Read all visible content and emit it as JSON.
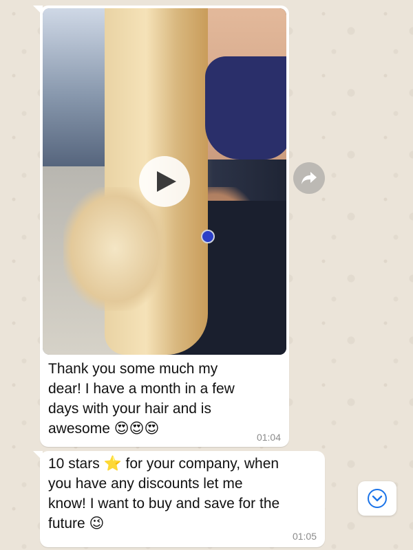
{
  "messages": [
    {
      "type": "video",
      "text": "Thank you some much my\ndear! I have a month in a few\ndays with your hair and is\nawesome 😍😍😍",
      "time": "01:04"
    },
    {
      "type": "text",
      "text": "10 stars ⭐️ for your company, when\nyou have any discounts let me\nknow! I want to buy and save for the\nfuture 😉",
      "time": "01:05"
    }
  ],
  "icons": {
    "play": "play-icon",
    "forward": "forward-icon",
    "scroll_down": "chevron-down-icon"
  },
  "colors": {
    "bubble": "#ffffff",
    "background": "#ece5dd",
    "accent": "#1a73e8"
  }
}
